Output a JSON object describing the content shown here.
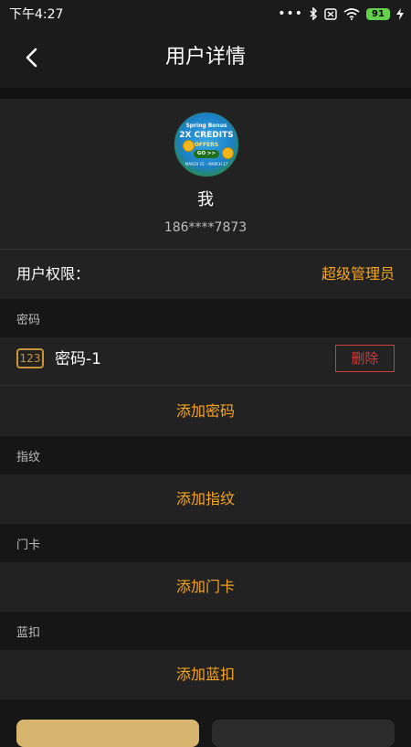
{
  "status_bar": {
    "time": "下午4:27",
    "battery": "91",
    "icons": [
      "more-dots-icon",
      "bluetooth-icon",
      "no-sim-icon",
      "wifi-icon",
      "battery-icon",
      "charging-icon"
    ]
  },
  "header": {
    "title": "用户详情",
    "back_icon": "chevron-left-icon"
  },
  "profile": {
    "avatar_text": {
      "line1": "Spring Bonus",
      "line2": "2X CREDITS",
      "line3": "OFFERS",
      "button": "GO >>",
      "line4": "MARCH 15 – MARCH 17"
    },
    "name": "我",
    "phone": "186****7873"
  },
  "permission": {
    "label": "用户权限：",
    "value": "超级管理员"
  },
  "sections": {
    "password": {
      "label": "密码",
      "item_icon": "123",
      "item_name": "密码-1",
      "delete_label": "删除",
      "add_label": "添加密码"
    },
    "fingerprint": {
      "label": "指纹",
      "add_label": "添加指纹"
    },
    "card": {
      "label": "门卡",
      "add_label": "添加门卡"
    },
    "bluetooth_key": {
      "label": "蓝扣",
      "add_label": "添加蓝扣"
    }
  },
  "colors": {
    "accent": "#f5a623",
    "danger": "#d43a3a",
    "background": "#161616",
    "card": "#222222"
  }
}
